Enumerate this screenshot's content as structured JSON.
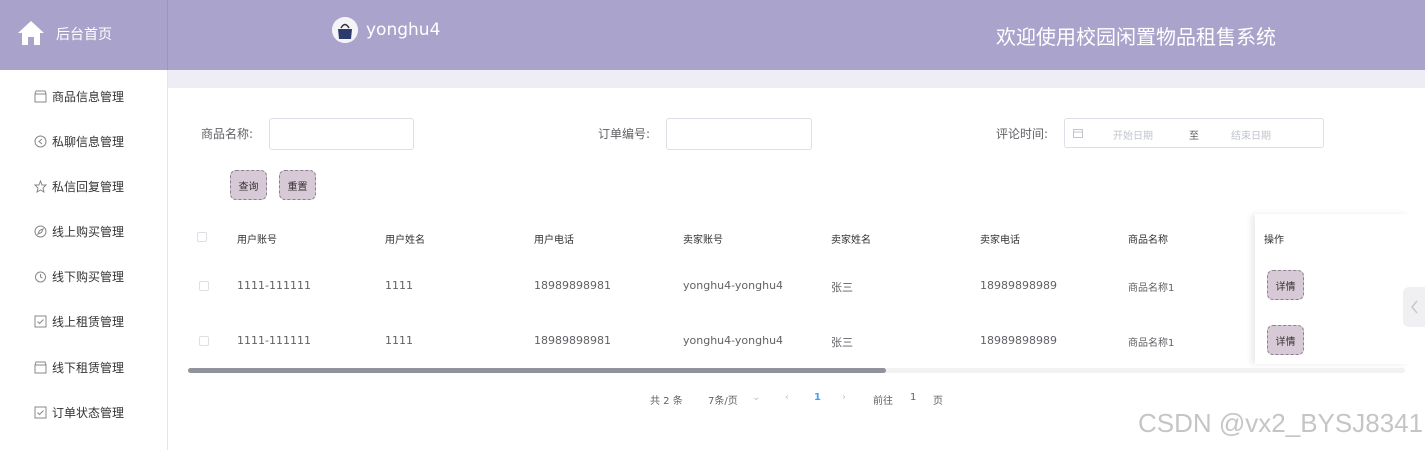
{
  "header": {
    "brand": "后台首页",
    "username": "yonghu4",
    "system_title": "欢迎使用校园闲置物品租售系统"
  },
  "sidebar": {
    "items": [
      {
        "label": "商品信息管理",
        "icon": "shop-icon"
      },
      {
        "label": "私聊信息管理",
        "icon": "chat-icon"
      },
      {
        "label": "私信回复管理",
        "icon": "star-icon"
      },
      {
        "label": "线上购买管理",
        "icon": "compass-icon"
      },
      {
        "label": "线下购买管理",
        "icon": "timer-icon"
      },
      {
        "label": "线上租赁管理",
        "icon": "check-square-icon"
      },
      {
        "label": "线下租赁管理",
        "icon": "shop-icon"
      },
      {
        "label": "订单状态管理",
        "icon": "check-square-icon"
      }
    ]
  },
  "filters": {
    "product_name_label": "商品名称:",
    "product_name_value": "",
    "order_no_label": "订单编号:",
    "order_no_value": "",
    "comment_time_label": "评论时间:",
    "start_placeholder": "开始日期",
    "range_sep": "至",
    "end_placeholder": "结束日期",
    "query_label": "查询",
    "reset_label": "重置"
  },
  "table": {
    "headers": [
      "用户账号",
      "用户姓名",
      "用户电话",
      "卖家账号",
      "卖家姓名",
      "卖家电话",
      "商品名称",
      "操作"
    ],
    "rows": [
      [
        "1111-111111",
        "1111",
        "18989898981",
        "yonghu4-yonghu4",
        "张三",
        "18989898989",
        "商品名称1",
        "详情"
      ],
      [
        "1111-111111",
        "1111",
        "18989898981",
        "yonghu4-yonghu4",
        "张三",
        "18989898989",
        "商品名称1",
        "详情"
      ]
    ]
  },
  "pagination": {
    "total": "共 2 条",
    "page_size": "7条/页",
    "current": "1",
    "goto_prefix": "前往",
    "goto_value": "1",
    "goto_suffix": "页"
  },
  "watermark": "CSDN @vx2_BYSJ8341",
  "colors": {
    "header_bg": "#aaa3cc",
    "button_bg": "#d8c9d6",
    "accent": "#409eff"
  }
}
